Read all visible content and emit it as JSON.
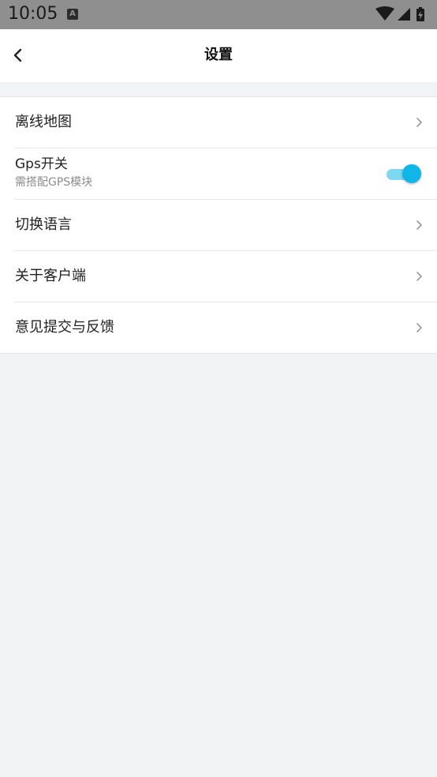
{
  "status_bar": {
    "time": "10:05",
    "notification_icon_letter": "A",
    "icons": [
      "wifi-icon",
      "cell-signal-icon",
      "battery-charging-icon"
    ]
  },
  "header": {
    "title": "设置",
    "back_icon": "chevron-left-icon"
  },
  "settings": {
    "offline_map": {
      "label": "离线地图"
    },
    "gps": {
      "label": "Gps开关",
      "sublabel": "需搭配GPS模块",
      "enabled": true
    },
    "language": {
      "label": "切换语言"
    },
    "about": {
      "label": "关于客户端"
    },
    "feedback": {
      "label": "意见提交与反馈"
    }
  },
  "colors": {
    "status_bar": "#8f8f8f",
    "background": "#f2f3f5",
    "toggle_on": "#11b6e8",
    "toggle_track": "#7fd8ef"
  }
}
